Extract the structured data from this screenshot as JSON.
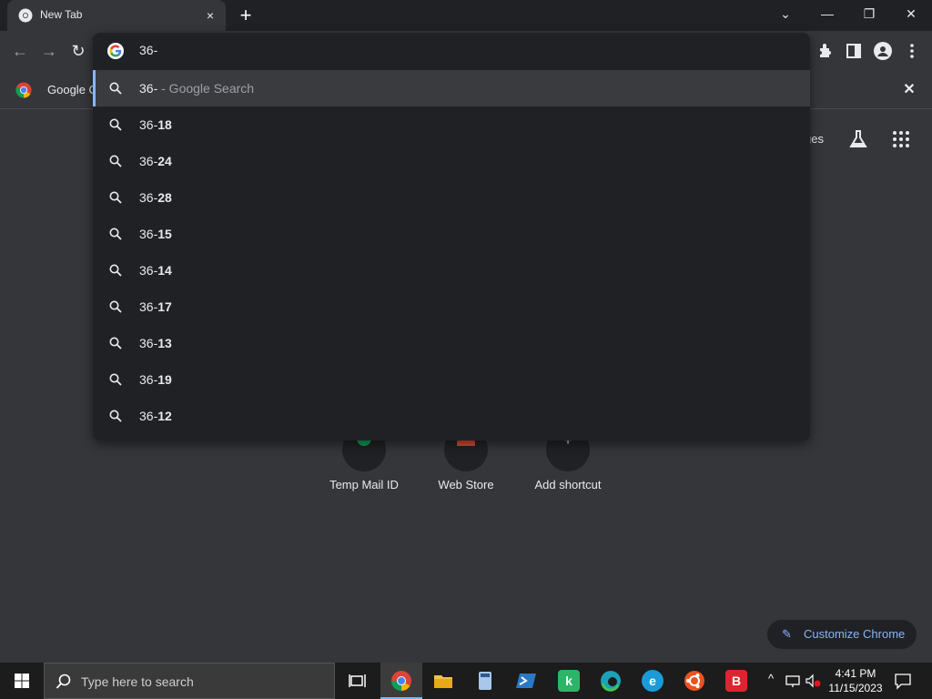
{
  "browser": {
    "tab_title": "New Tab",
    "tab_close": "×",
    "new_tab": "+"
  },
  "window_controls": {
    "dropdown": "⌄",
    "minimize": "—",
    "restore": "❐",
    "close": "✕"
  },
  "omnibox": {
    "input_value": "36-",
    "suggestions": [
      {
        "prefix": "36-",
        "bold": "",
        "suffix": " - Google Search"
      },
      {
        "prefix": "36-",
        "bold": "18",
        "suffix": ""
      },
      {
        "prefix": "36-",
        "bold": "24",
        "suffix": ""
      },
      {
        "prefix": "36-",
        "bold": "28",
        "suffix": ""
      },
      {
        "prefix": "36-",
        "bold": "15",
        "suffix": ""
      },
      {
        "prefix": "36-",
        "bold": "14",
        "suffix": ""
      },
      {
        "prefix": "36-",
        "bold": "17",
        "suffix": ""
      },
      {
        "prefix": "36-",
        "bold": "13",
        "suffix": ""
      },
      {
        "prefix": "36-",
        "bold": "19",
        "suffix": ""
      },
      {
        "prefix": "36-",
        "bold": "12",
        "suffix": ""
      }
    ]
  },
  "bookmarks": {
    "first_item": "Google C",
    "close": "✕"
  },
  "ntp": {
    "images_link_partial": "ges",
    "shortcuts": [
      {
        "label": "Temp Mail ID"
      },
      {
        "label": "Web Store"
      },
      {
        "label": "Add shortcut"
      }
    ],
    "add_shortcut_glyph": "+",
    "customize_label": "Customize Chrome"
  },
  "taskbar": {
    "search_placeholder": "Type here to search",
    "apps": [
      {
        "name": "task-view"
      },
      {
        "name": "chrome",
        "active": true
      },
      {
        "name": "file-explorer"
      },
      {
        "name": "calculator"
      },
      {
        "name": "powershell"
      },
      {
        "name": "kaspersky",
        "glyph": "k"
      },
      {
        "name": "edge"
      },
      {
        "name": "edge-legacy",
        "glyph": "e"
      },
      {
        "name": "ubuntu"
      },
      {
        "name": "bitdefender",
        "glyph": "B"
      }
    ],
    "time": "4:41 PM",
    "date": "11/15/2023"
  },
  "colors": {
    "accent": "#8ab4f8",
    "omnibox_bg": "#202124",
    "page_bg": "#35363a",
    "taskbar_bg": "#1c1c1c"
  }
}
